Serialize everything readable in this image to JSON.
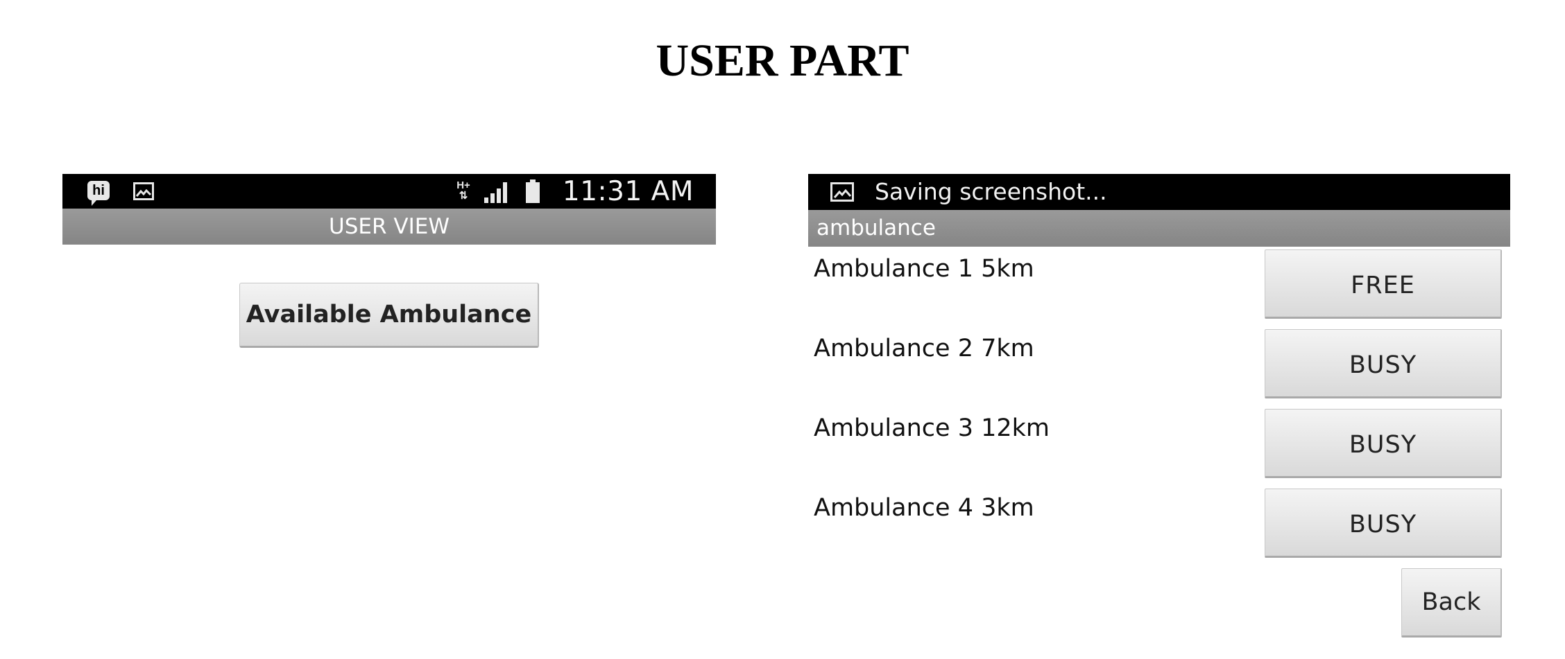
{
  "page": {
    "title": "USER PART"
  },
  "left_screen": {
    "status_bar": {
      "icons": [
        "hi-messenger-icon",
        "picture-icon",
        "network-hplus-icon",
        "signal-icon",
        "battery-icon"
      ],
      "hplus_label": "H+",
      "time": "11:31 AM"
    },
    "title": "USER VIEW",
    "available_button_label": "Available Ambulance"
  },
  "right_screen": {
    "notification": {
      "icon": "picture-icon",
      "text": "Saving screenshot..."
    },
    "action_bar_title": "ambulance",
    "ambulances": [
      {
        "label": "Ambulance 1 5km",
        "status": "FREE"
      },
      {
        "label": "Ambulance 2 7km",
        "status": "BUSY"
      },
      {
        "label": "Ambulance 3 12km",
        "status": "BUSY"
      },
      {
        "label": "Ambulance 4 3km",
        "status": "BUSY"
      }
    ],
    "back_button_label": "Back"
  }
}
